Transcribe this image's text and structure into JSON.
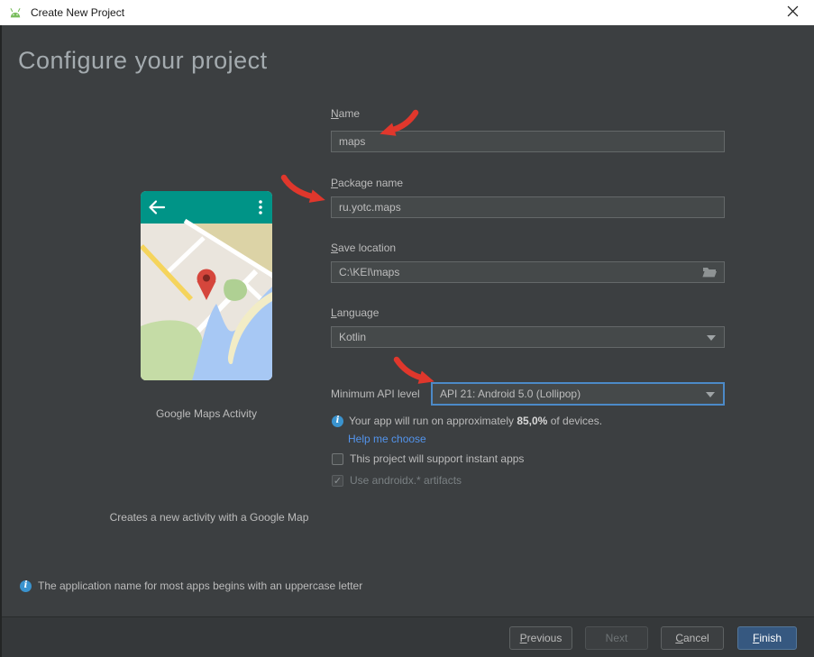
{
  "window": {
    "title": "Create New Project"
  },
  "header": {
    "title": "Configure your project"
  },
  "template": {
    "name": "Google Maps Activity",
    "description": "Creates a new activity with a Google Map"
  },
  "form": {
    "name": {
      "label": "Name",
      "value": "maps"
    },
    "package": {
      "label": "Package name",
      "value": "ru.yotc.maps"
    },
    "save_location": {
      "label": "Save location",
      "value": "C:\\KEI\\maps"
    },
    "language": {
      "label": "Language",
      "value": "Kotlin"
    },
    "min_api": {
      "label": "Minimum API level",
      "value": "API 21: Android 5.0 (Lollipop)"
    },
    "api_info": {
      "prefix": "Your app will run on approximately ",
      "percent": "85,0%",
      "suffix": " of devices."
    },
    "help_link": "Help me choose",
    "instant_apps": {
      "label": "This project will support instant apps",
      "checked": false
    },
    "androidx": {
      "label": "Use androidx.* artifacts",
      "checked": true,
      "check_glyph": "✓"
    }
  },
  "footer": {
    "info": "The application name for most apps begins with an uppercase letter",
    "buttons": {
      "previous": "Previous",
      "next": "Next",
      "cancel": "Cancel",
      "finish": "Finish"
    }
  },
  "colors": {
    "titlebar_bg": "#ffffff",
    "body_bg": "#3c3f41",
    "field_bg": "#45494a",
    "focus_border": "#4c8ac8",
    "link_blue": "#5394ec",
    "finish_blue": "#365880",
    "arrow_red": "#e0372c",
    "appbar_teal": "#009487",
    "android_green": "#77bc5b"
  }
}
